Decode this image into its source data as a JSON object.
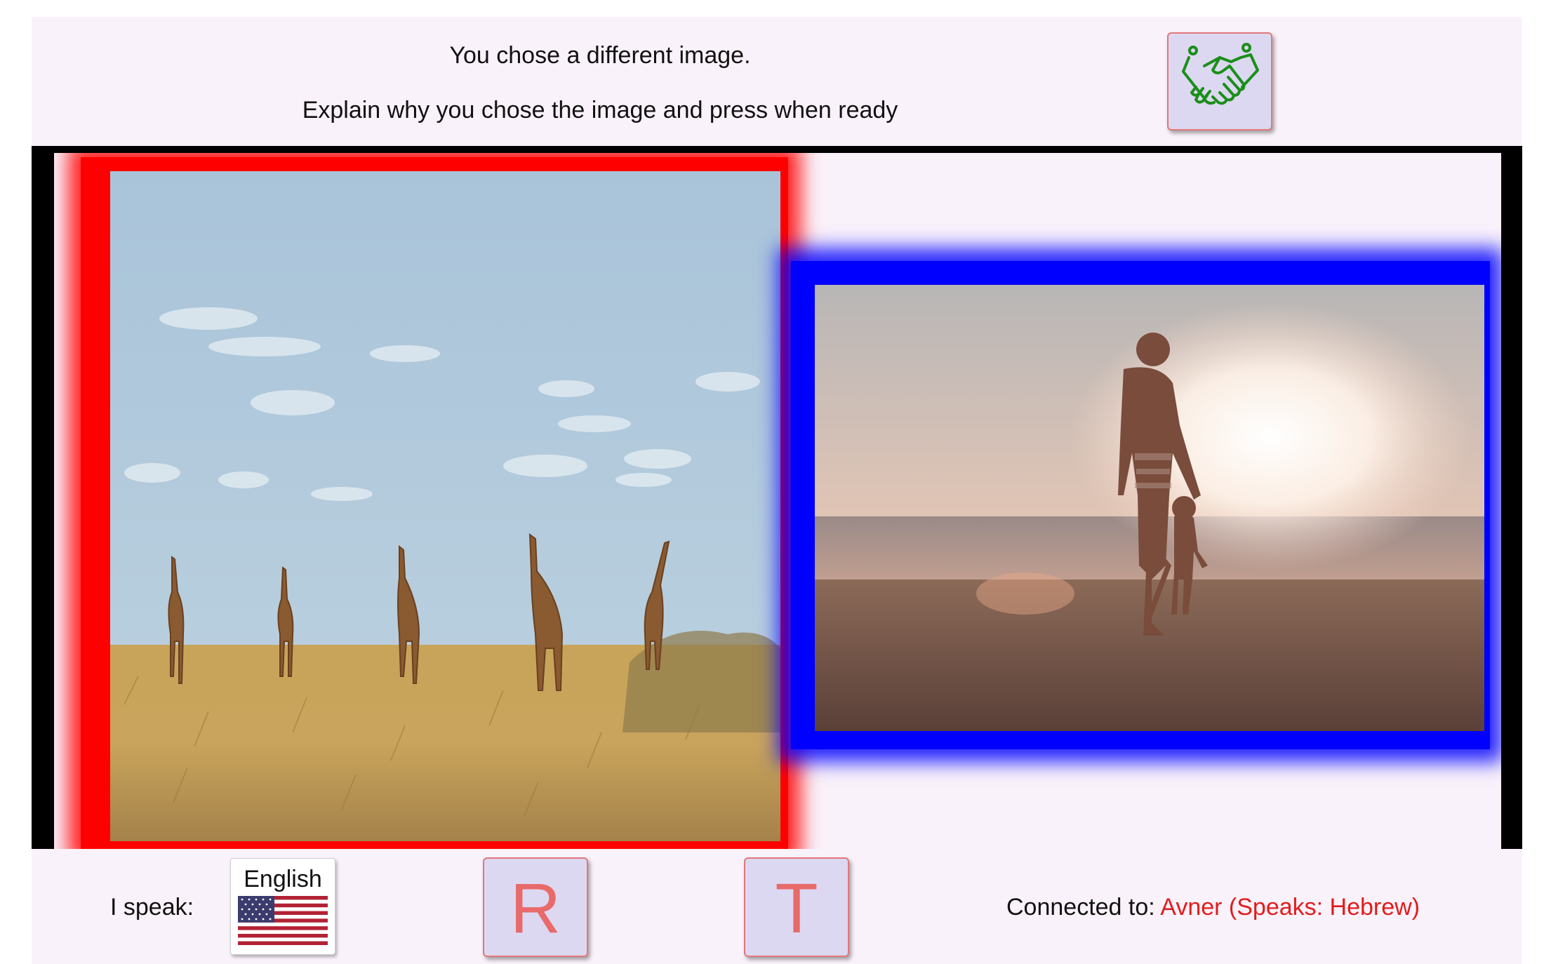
{
  "header": {
    "line1": "You chose a different image.",
    "line2": "Explain why you chose the image and press when ready",
    "action_icon": "handshake-icon",
    "action_icon_color": "#1a8f1a"
  },
  "images": {
    "left": {
      "highlight_color": "#ff0000",
      "subject": "giraffes-savanna"
    },
    "right": {
      "highlight_color": "#0000ff",
      "subject": "beach-sunset"
    }
  },
  "footer": {
    "speak_label": "I speak:",
    "language": "English",
    "language_flag": "us-flag-icon",
    "r_label": "R",
    "t_label": "T",
    "connected_prefix": "Connected to:",
    "connected_who": "Avner (Speaks: Hebrew)",
    "connected_color": "#e01d1d",
    "button_letter_color": "#e86a6a"
  }
}
